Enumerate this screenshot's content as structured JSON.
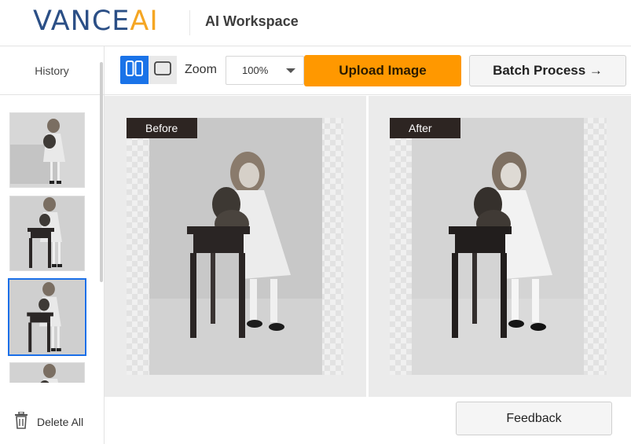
{
  "header": {
    "logo_main": "VANCE",
    "logo_ai": "AI",
    "workspace_title": "AI Workspace"
  },
  "sidebar": {
    "history_label": "History",
    "delete_all_label": "Delete All",
    "thumbnails_count_visible": 4,
    "selected_thumbnail": 3
  },
  "toolbar": {
    "zoom_label": "Zoom",
    "zoom_value": "100%",
    "upload_label": "Upload Image",
    "batch_label": "Batch Process →"
  },
  "compare": {
    "before_label": "Before",
    "after_label": "After"
  },
  "footer": {
    "feedback_label": "Feedback"
  },
  "colors": {
    "brand_blue": "#2b4f86",
    "brand_orange": "#f5a623",
    "accent_blue": "#1a73e8",
    "upload_orange": "#ff9800",
    "tag_dark": "#2d2522"
  },
  "icons": {
    "split_view": "split-view-icon",
    "single_view": "single-view-icon",
    "dropdown": "chevron-down-icon",
    "trash": "trash-icon"
  }
}
